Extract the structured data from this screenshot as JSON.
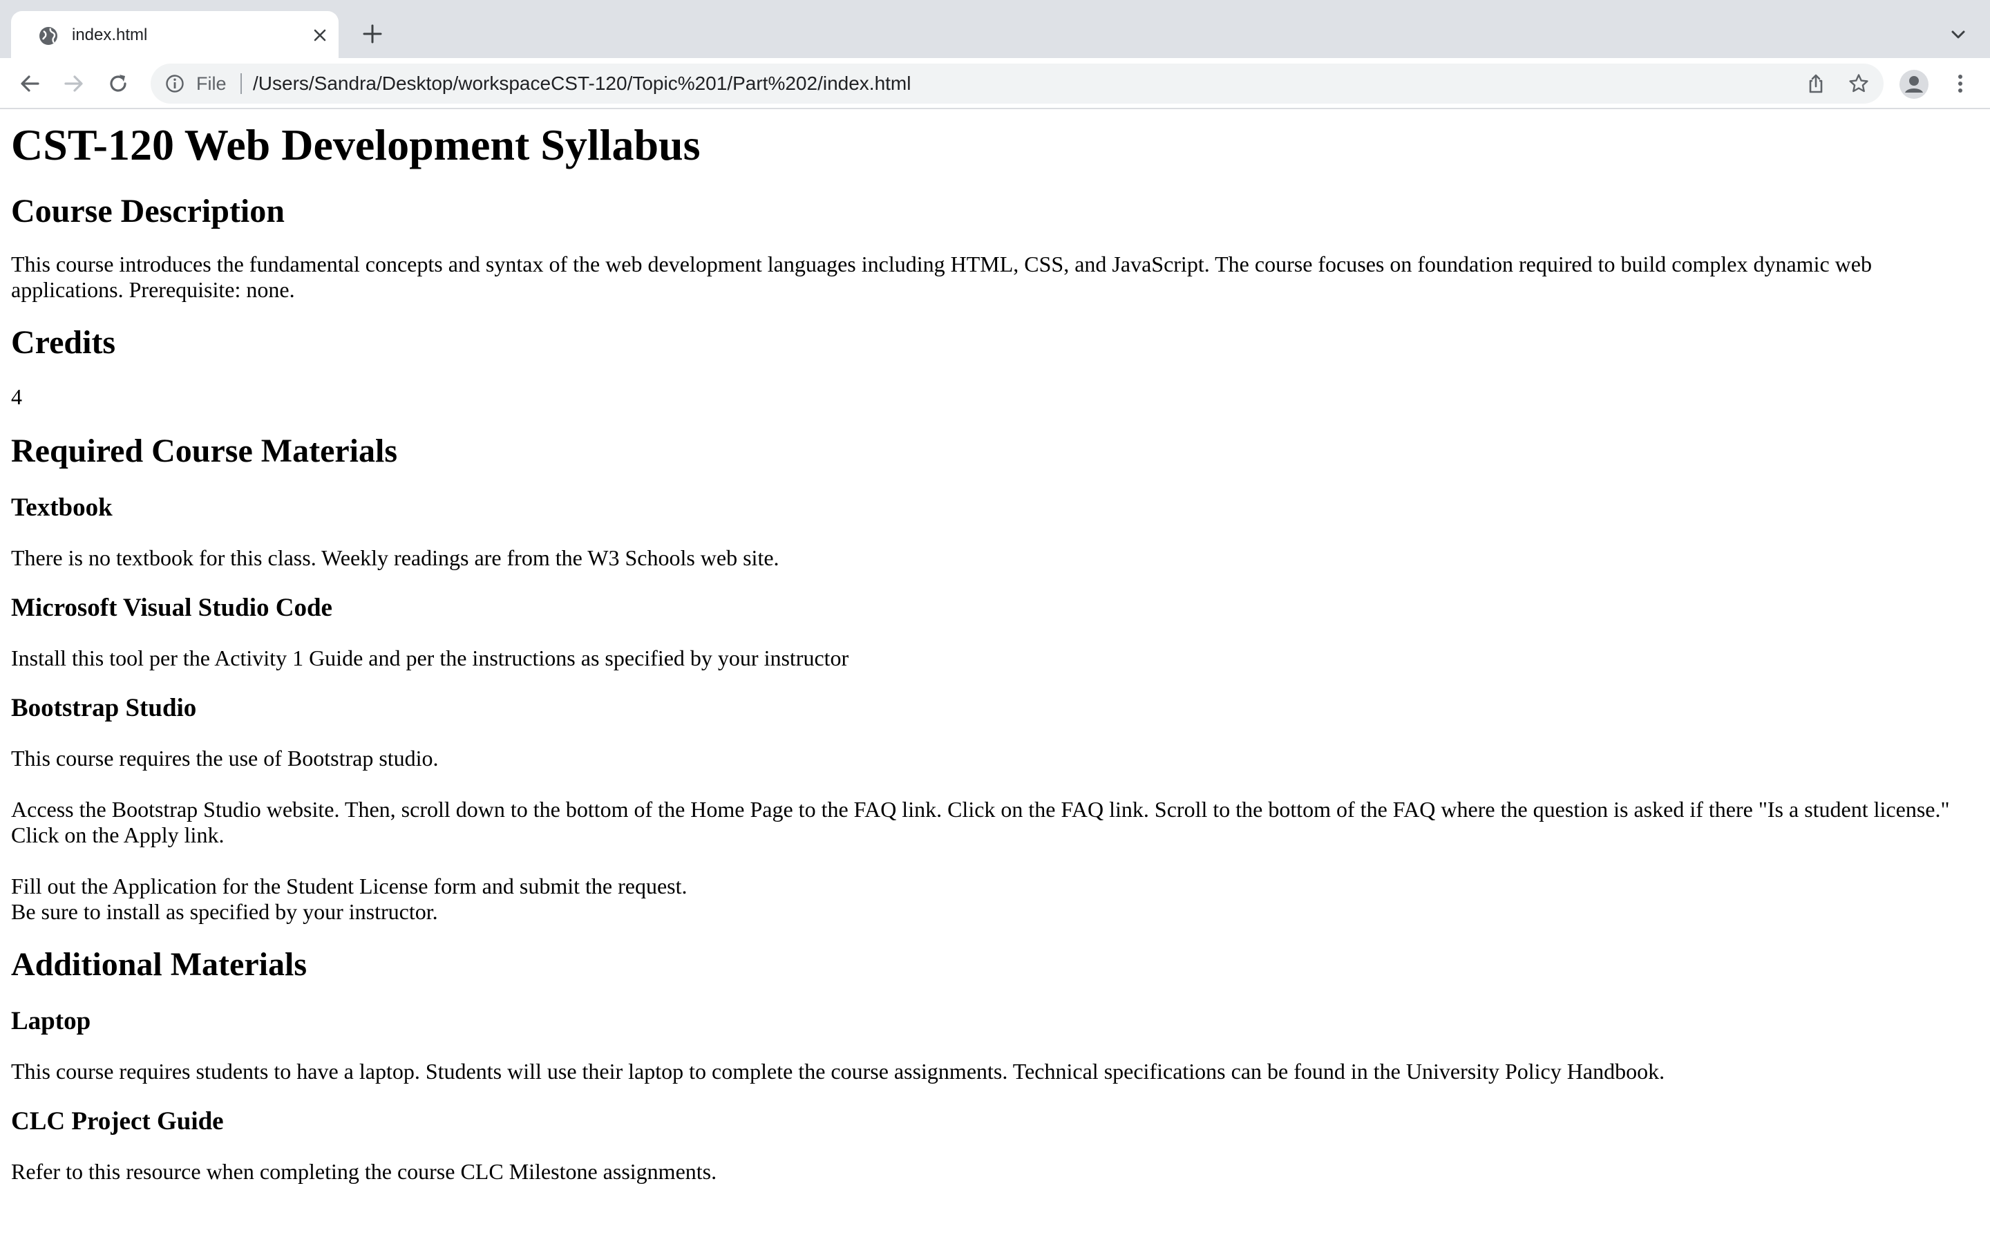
{
  "browser": {
    "tab": {
      "title": "index.html"
    },
    "address_bar": {
      "scheme_label": "File",
      "url": "/Users/Sandra/Desktop/workspaceCST-120/Topic%201/Part%202/index.html"
    },
    "icons": {
      "favicon": "globe-icon",
      "tab_close": "close-icon",
      "new_tab": "plus-icon",
      "tab_search": "chevron-down-icon",
      "back": "arrow-left-icon",
      "forward": "arrow-right-icon",
      "reload": "reload-icon",
      "site_info": "info-icon",
      "share": "share-icon",
      "bookmark": "star-icon",
      "profile": "person-icon",
      "menu": "kebab-menu-icon"
    },
    "colors": {
      "tabstrip_bg": "#dee1e6",
      "omnibox_bg": "#f1f3f4",
      "icon": "#5f6368"
    }
  },
  "page": {
    "title": "CST-120 Web Development Syllabus",
    "course_description": {
      "heading": "Course Description",
      "text": "This course introduces the fundamental concepts and syntax of the web development languages including HTML, CSS, and JavaScript. The course focuses on foundation required to build complex dynamic web applications. Prerequisite: none."
    },
    "credits": {
      "heading": "Credits",
      "value": "4"
    },
    "required_materials": {
      "heading": "Required Course Materials",
      "textbook": {
        "heading": "Textbook",
        "text": "There is no textbook for this class. Weekly readings are from the W3 Schools web site."
      },
      "vscode": {
        "heading": "Microsoft Visual Studio Code",
        "text": "Install this tool per the Activity 1 Guide and per the instructions as specified by your instructor"
      },
      "bootstrap_studio": {
        "heading": "Bootstrap Studio",
        "text1": "This course requires the use of Bootstrap studio.",
        "text2": "Access the Bootstrap Studio website. Then, scroll down to the bottom of the Home Page to the FAQ link. Click on the FAQ link. Scroll to the bottom of the FAQ where the question is asked if there \"Is a student license.\" Click on the Apply link.",
        "text3_line1": "Fill out the Application for the Student License form and submit the request.",
        "text3_line2": "Be sure to install as specified by your instructor."
      }
    },
    "additional_materials": {
      "heading": "Additional Materials",
      "laptop": {
        "heading": "Laptop",
        "text": "This course requires students to have a laptop. Students will use their laptop to complete the course assignments. Technical specifications can be found in the University Policy Handbook."
      },
      "clc": {
        "heading": "CLC Project Guide",
        "text": "Refer to this resource when completing the course CLC Milestone assignments."
      }
    }
  }
}
